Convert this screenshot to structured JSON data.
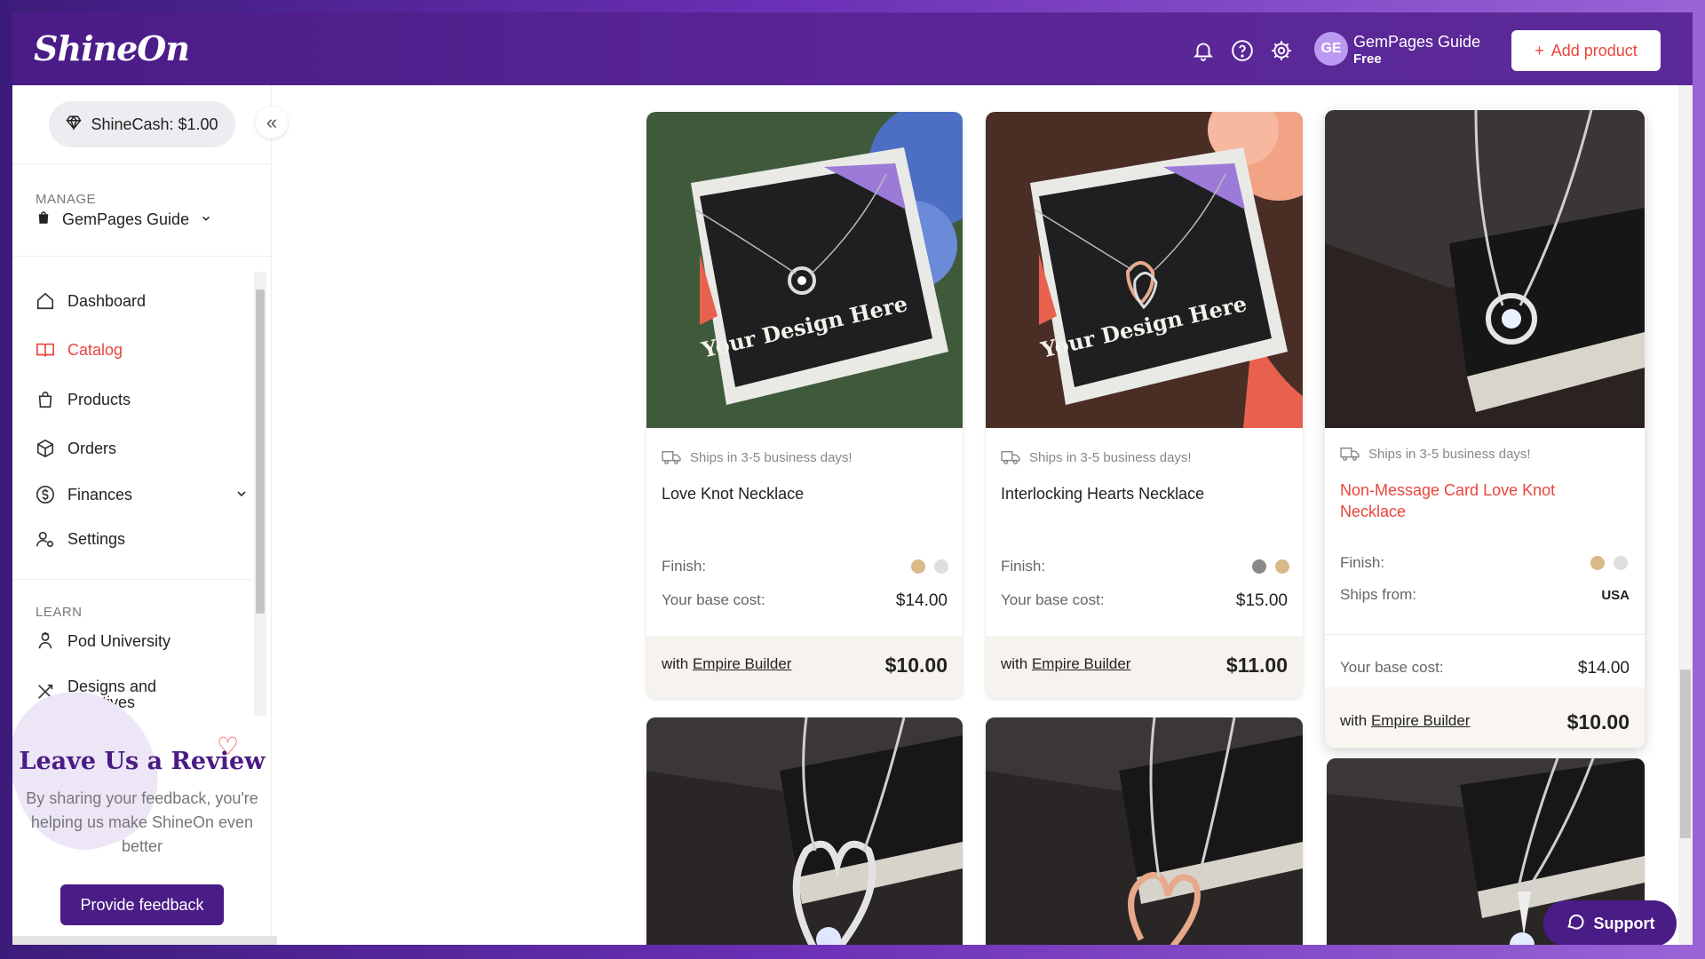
{
  "header": {
    "logo": "ShineOn",
    "user": {
      "initials": "GE",
      "name": "GemPages Guide",
      "plan": "Free"
    },
    "add_product_label": "Add product"
  },
  "sidebar": {
    "shinecash": "ShineCash: $1.00",
    "manage_label": "MANAGE",
    "store_name": "GemPages Guide",
    "nav": [
      {
        "label": "Dashboard",
        "icon": "home-icon"
      },
      {
        "label": "Catalog",
        "icon": "book-icon",
        "active": true
      },
      {
        "label": "Products",
        "icon": "bag-icon"
      },
      {
        "label": "Orders",
        "icon": "box-icon"
      },
      {
        "label": "Finances",
        "icon": "dollar-icon"
      },
      {
        "label": "Settings",
        "icon": "user-gear-icon"
      }
    ],
    "learn_label": "LEARN",
    "learn_nav": [
      {
        "label": "Pod University",
        "icon": "graduate-icon"
      },
      {
        "label": "Designs and Creatives",
        "icon": "tools-icon"
      }
    ],
    "review": {
      "title": "Leave Us a Review",
      "text": "By sharing your feedback, you're helping us make ShineOn even better",
      "button": "Provide feedback"
    }
  },
  "products": [
    {
      "ship": "Ships in 3-5 business days!",
      "name": "Love Knot Necklace",
      "finish_label": "Finish:",
      "finishes": [
        "#d9b98a",
        "#dedede"
      ],
      "base_cost_label": "Your base cost:",
      "base_cost": "$14.00",
      "empire_prefix": "with",
      "empire_link": "Empire Builder",
      "empire_price": "$10.00",
      "image_text": "Your Design Here"
    },
    {
      "ship": "Ships in 3-5 business days!",
      "name": "Interlocking Hearts Necklace",
      "finish_label": "Finish:",
      "finishes": [
        "#8a8a8a",
        "#d9b98a"
      ],
      "base_cost_label": "Your base cost:",
      "base_cost": "$15.00",
      "empire_prefix": "with",
      "empire_link": "Empire Builder",
      "empire_price": "$11.00",
      "image_text": "Your Design Here"
    },
    {
      "ship": "Ships in 3-5 business days!",
      "name": "Non-Message Card Love Knot Necklace",
      "finish_label": "Finish:",
      "finishes": [
        "#d9b98a",
        "#dedede"
      ],
      "ships_from_label": "Ships from:",
      "ships_from": "USA",
      "base_cost_label": "Your base cost:",
      "base_cost": "$14.00",
      "empire_prefix": "with",
      "empire_link": "Empire Builder",
      "empire_price": "$10.00"
    }
  ],
  "support_label": "Support",
  "colors": {
    "brand": "#4a1c86",
    "accent": "#e8453c"
  }
}
